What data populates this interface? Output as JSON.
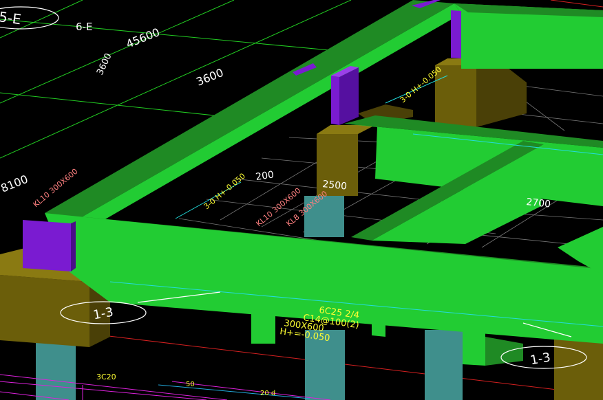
{
  "axis_bubbles": {
    "top_left": "5-E",
    "left_bottom": "1-3",
    "right_bottom": "1-3"
  },
  "grid_labels": {
    "axis_6e": "6-E"
  },
  "dimensions": {
    "overall": "45600",
    "span_a": "3600",
    "span_b": "3600",
    "bay_depth": "8100",
    "inner_a": "200",
    "inner_b": "2500",
    "inner_c": "2700"
  },
  "beam_annotation": {
    "line1": "6C25 2/4",
    "line2": "C14@100(2)",
    "line3": "300X600",
    "line4": "H+=-0.050"
  },
  "misc_labels": {
    "left_note": "KL10 300X600",
    "mid_note_a": "KL10 300X600",
    "mid_note_b": "KL8 300X600",
    "small_1": "3C20",
    "small_2": "50",
    "small_3": "20 d",
    "pier_note_a": "3-0 H+-0.050",
    "pier_note_b": "3-0 H+-0.050"
  },
  "colors": {
    "beam_face": "#22cc33",
    "beam_top": "#1f8a24",
    "column": "#7a1bd1",
    "pile_cap": "#6b5e0a",
    "pier": "#3f8f8c",
    "grid": "#22dd22"
  }
}
